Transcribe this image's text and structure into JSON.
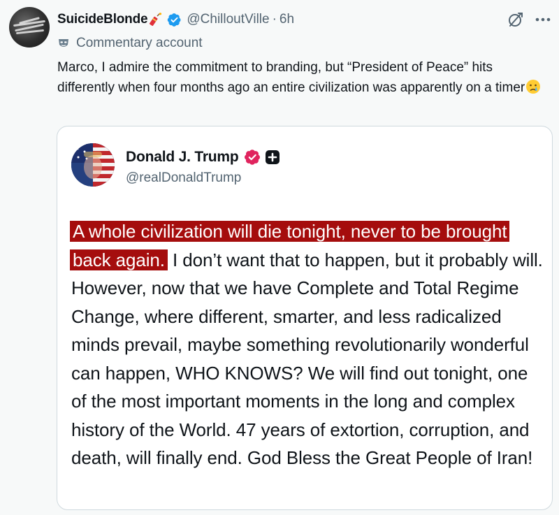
{
  "reply": {
    "author": {
      "display_name": "SuicideBlonde",
      "name_emoji": "firecracker-emoji",
      "verified": true,
      "handle": "@ChilloutVille",
      "separator": "·",
      "time": "6h",
      "label": "Commentary account",
      "label_icon": "mask-icon"
    },
    "text": "Marco, I admire the commitment to branding, but “President of Peace” hits differently when four months ago an entire civilization was apparently on a timer",
    "trailing_emoji": "crying-face-emoji",
    "actions": {
      "grok_icon": "grok-icon",
      "more_icon": "more-dots-icon"
    }
  },
  "quoted": {
    "author": {
      "display_name": "Donald J. Trump",
      "verified_badge": "pink-verified-badge",
      "extra_badge": "plus-badge",
      "handle": "@realDonaldTrump"
    },
    "highlighted_text": "A whole civilization will die tonight, never to be brought back again.",
    "body_text": " I don’t want that to happen, but it probably will. However, now that we have Complete and Total Regime Change, where different, smarter, and less radicalized minds prevail, maybe something revolutionarily wonderful can happen, WHO KNOWS? We will find out tonight, one of the most important moments in the long and complex history of the World. 47 years of extortion, corruption, and death, will finally end. God Bless the Great People of Iran!"
  },
  "colors": {
    "background": "#f7f9f9",
    "card": "#ffffff",
    "text_primary": "#0f1419",
    "text_secondary": "#536471",
    "verified_blue": "#1d9bf0",
    "verified_pink": "#e0245e",
    "highlight_red": "#a50d0d",
    "border": "#cfd9de"
  }
}
